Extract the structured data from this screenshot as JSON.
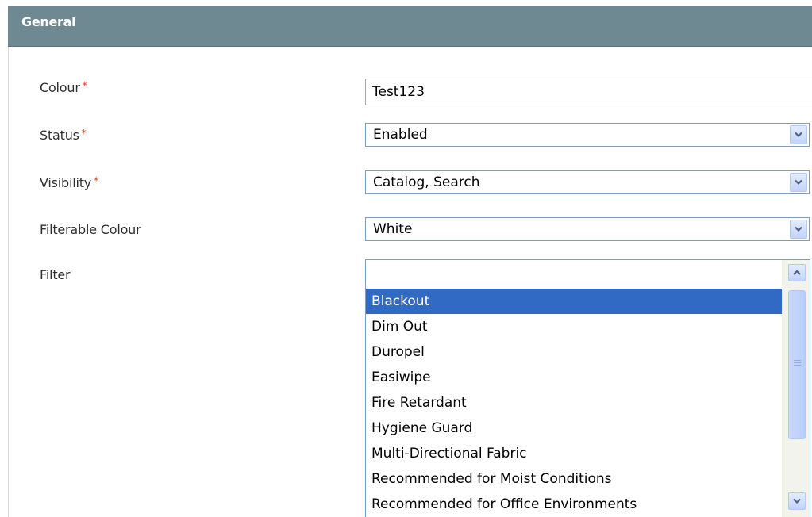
{
  "section": {
    "title": "General"
  },
  "fields": {
    "colour": {
      "label": "Colour",
      "required_mark": "*",
      "value": "Test123"
    },
    "status": {
      "label": "Status",
      "required_mark": "*",
      "value": "Enabled"
    },
    "visibility": {
      "label": "Visibility",
      "required_mark": "*",
      "value": "Catalog, Search"
    },
    "filterable_colour": {
      "label": "Filterable Colour",
      "value": "White"
    },
    "filter": {
      "label": "Filter",
      "options": [
        {
          "label": "Blackout",
          "selected": true
        },
        {
          "label": "Dim Out",
          "selected": false
        },
        {
          "label": "Duropel",
          "selected": false
        },
        {
          "label": "Easiwipe",
          "selected": false
        },
        {
          "label": "Fire Retardant",
          "selected": false
        },
        {
          "label": "Hygiene Guard",
          "selected": false
        },
        {
          "label": "Multi-Directional Fabric",
          "selected": false
        },
        {
          "label": "Recommended for Moist Conditions",
          "selected": false
        },
        {
          "label": "Recommended for Office Environments",
          "selected": false
        }
      ]
    }
  },
  "icons": {
    "dropdown": "chevron-down-icon",
    "scroll_up": "chevron-up-icon",
    "scroll_down": "chevron-down-icon"
  },
  "colors": {
    "header_bg": "#6f8992",
    "required_mark": "#eb340a",
    "selection": "#316ac5"
  }
}
